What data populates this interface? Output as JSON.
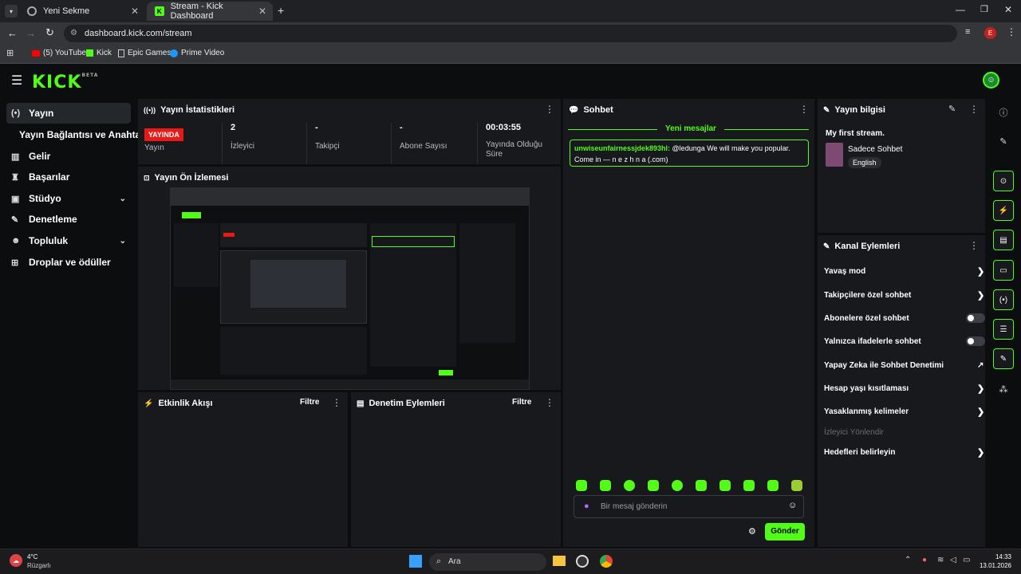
{
  "browser": {
    "tabs": [
      {
        "label": "Yeni Sekme",
        "icon": "chrome-newtab-icon"
      },
      {
        "label": "Stream - Kick Dashboard",
        "icon": "kick-icon"
      }
    ],
    "url": "dashboard.kick.com/stream",
    "profile_initial": "E",
    "bookmarks": [
      {
        "label": "(5) YouTube"
      },
      {
        "label": "Kick"
      },
      {
        "label": "Epic Games"
      },
      {
        "label": "Prime Video"
      }
    ]
  },
  "app": {
    "logo": "KICK",
    "logo_sup": "BETA",
    "accent": "#53fc18",
    "sidebar": [
      {
        "label": "Yayın",
        "icon": "broadcast-icon",
        "active": true
      },
      {
        "label": "Yayın Bağlantısı ve Anahtarı"
      },
      {
        "label": "Gelir",
        "icon": "chart-icon"
      },
      {
        "label": "Başarılar",
        "icon": "trophy-icon"
      },
      {
        "label": "Stüdyo",
        "icon": "studio-icon",
        "expand": true
      },
      {
        "label": "Denetleme",
        "icon": "wrench-icon"
      },
      {
        "label": "Topluluk",
        "icon": "people-icon",
        "expand": true
      },
      {
        "label": "Droplar ve ödüller",
        "icon": "gift-icon"
      }
    ],
    "stats_panel": {
      "title": "Yayın İstatistikleri",
      "live_badge": "YAYINDA",
      "stats": [
        {
          "value": "",
          "label": "Yayın"
        },
        {
          "value": "2",
          "label": "İzleyici"
        },
        {
          "value": "-",
          "label": "Takipçi"
        },
        {
          "value": "-",
          "label": "Abone Sayısı"
        },
        {
          "value": "00:03:55",
          "label": "Yayında Olduğu Süre"
        }
      ]
    },
    "preview_panel": {
      "title": "Yayın Ön İzlemesi"
    },
    "activity_panel": {
      "title": "Etkinlik Akışı",
      "filter": "Filtre"
    },
    "mod_panel": {
      "title": "Denetim Eylemleri",
      "filter": "Filtre"
    },
    "chat": {
      "title": "Sohbet",
      "new_messages": "Yeni mesajlar",
      "message_user": "unwiseunfairnessjdek893hl:",
      "message_text": " @ledunga We will make you popular. Come in — n e z h n a (.com)",
      "input_placeholder": "Bir mesaj gönderin",
      "send": "Gönder"
    },
    "info_panel": {
      "title": "Yayın bilgisi",
      "stream_title": "My first stream.",
      "category": "Sadece Sohbet",
      "language": "English"
    },
    "actions_panel": {
      "title": "Kanal Eylemleri",
      "items": [
        {
          "label": "Yavaş mod",
          "control": "arrow"
        },
        {
          "label": "Takipçilere özel sohbet",
          "control": "arrow"
        },
        {
          "label": "Abonelere özel sohbet",
          "control": "toggle"
        },
        {
          "label": "Yalnızca ifadelerle sohbet",
          "control": "toggle"
        },
        {
          "label": "Yapay Zeka ile Sohbet Denetimi",
          "control": "external"
        },
        {
          "label": "Hesap yaşı kısıtlaması",
          "control": "arrow"
        },
        {
          "label": "Yasaklanmış kelimeler",
          "control": "arrow"
        },
        {
          "label": "İzleyici Yönlendir",
          "control": "disabled"
        },
        {
          "label": "Hedefleri belirleyin",
          "control": "arrow"
        }
      ]
    }
  },
  "taskbar": {
    "weather_temp": "4°C",
    "weather_desc": "Rüzgarlı",
    "search": "Ara",
    "time": "14:33",
    "date": "13.01.2026"
  }
}
